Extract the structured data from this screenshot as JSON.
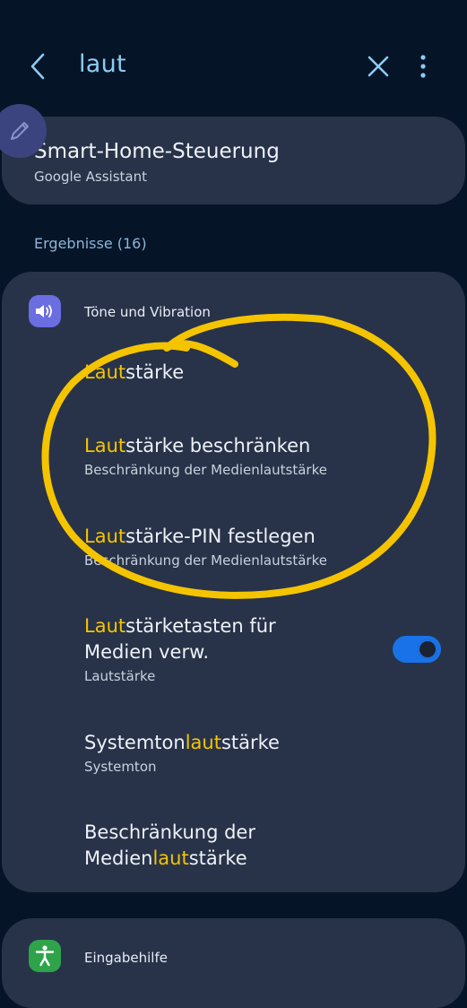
{
  "header": {
    "back_icon": "chevron-left-icon",
    "search_query": "laut",
    "clear_icon": "close-icon",
    "more_icon": "more-vertical-icon"
  },
  "top_result": {
    "title": "Smart-Home-Steuerung",
    "subtitle": "Google Assistant",
    "fab_icon": "pencil-icon"
  },
  "results_label": "Ergebnisse (16)",
  "category": {
    "title": "Töne und Vibration",
    "icon": "speaker-icon",
    "icon_color": "#6a6ee0",
    "items": [
      {
        "title_hl": "Laut",
        "title_rest": "stärke"
      },
      {
        "title_hl": "Laut",
        "title_rest": "stärke beschränken",
        "subtitle": "Beschränkung der Medienlautstärke"
      },
      {
        "title_hl": "Laut",
        "title_rest": "stärke-PIN festlegen",
        "subtitle": "Beschränkung der Medienlautstärke"
      },
      {
        "title_hl": "Laut",
        "title_rest_1": "stärketasten für",
        "title_rest_2": "Medien verw.",
        "subtitle": "Lautstärke",
        "toggle_on": true
      },
      {
        "title_pre": "Systemton",
        "title_hl": "laut",
        "title_rest": "stärke",
        "subtitle": "Systemton"
      },
      {
        "title_line1": "Beschränkung der",
        "title_pre": "Medien",
        "title_hl": "laut",
        "title_rest": "stärke"
      }
    ]
  },
  "next_category": {
    "title": "Eingabehilfe",
    "icon": "accessibility-icon",
    "icon_color": "#2fa34a"
  },
  "colors": {
    "background": "#061427",
    "card": "#283349",
    "highlight": "#f5c400",
    "accent": "#1a72e8",
    "annotation": "#f5c400"
  }
}
